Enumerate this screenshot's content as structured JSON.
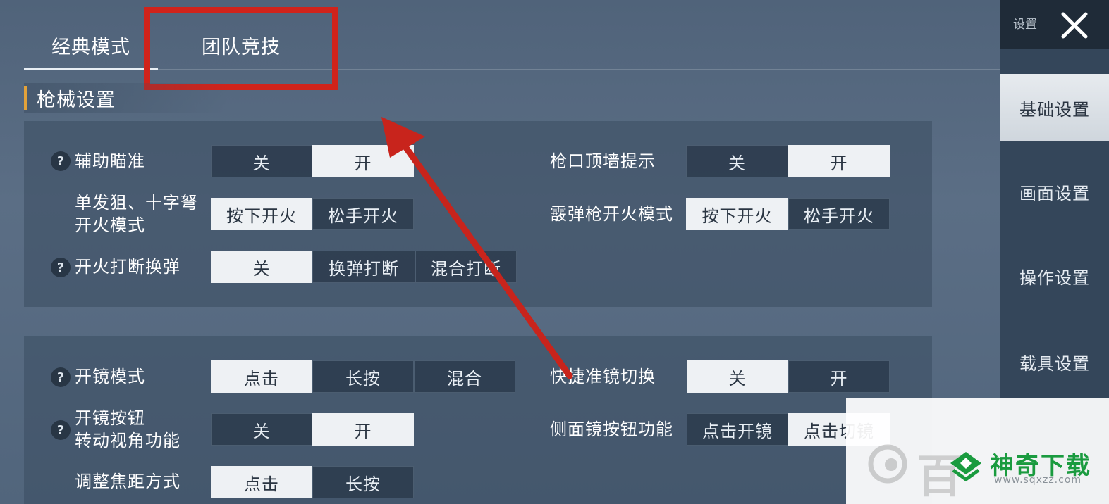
{
  "tabs": [
    {
      "label": "经典模式",
      "active": true
    },
    {
      "label": "团队竞技",
      "active": false
    }
  ],
  "section": {
    "title": "枪械设置"
  },
  "panel1": {
    "aim_assist": {
      "label": "辅助瞄准",
      "options": [
        "关",
        "开"
      ],
      "selected": "开"
    },
    "sniper_fire": {
      "label_line1": "单发狙、十字弩",
      "label_line2": "开火模式",
      "options": [
        "按下开火",
        "松手开火"
      ],
      "selected": "按下开火"
    },
    "fire_interrupt": {
      "label": "开火打断换弹",
      "options": [
        "关",
        "换弹打断",
        "混合打断"
      ],
      "selected": "关"
    },
    "muzzle_wall": {
      "label": "枪口顶墙提示",
      "options": [
        "关",
        "开"
      ],
      "selected": "开"
    },
    "shotgun_fire": {
      "label": "霰弹枪开火模式",
      "options": [
        "按下开火",
        "松手开火"
      ],
      "selected": "按下开火"
    }
  },
  "panel2": {
    "scope_mode": {
      "label": "开镜模式",
      "options": [
        "点击",
        "长按",
        "混合"
      ],
      "selected": "点击"
    },
    "scope_button": {
      "label_line1": "开镜按钮",
      "label_line2": "转动视角功能",
      "options": [
        "关",
        "开"
      ],
      "selected": "开"
    },
    "zoom_adjust": {
      "label": "调整焦距方式",
      "options": [
        "点击",
        "长按"
      ],
      "selected": "点击"
    },
    "quick_scope": {
      "label": "快捷准镜切换",
      "options": [
        "关",
        "开"
      ],
      "selected": "关"
    },
    "side_scope": {
      "label": "侧面镜按钮功能",
      "options": [
        "点击开镜",
        "点击切镜"
      ],
      "selected": "点击切镜"
    }
  },
  "sidebar": {
    "header": "设置",
    "items": [
      {
        "label": "基础设置",
        "active": true
      },
      {
        "label": "画面设置",
        "active": false
      },
      {
        "label": "操作设置",
        "active": false
      },
      {
        "label": "载具设置",
        "active": false
      }
    ]
  },
  "watermark": {
    "brand": "神奇下载",
    "url": "www.sqxzz.com",
    "partial": "百"
  },
  "colors": {
    "highlight": "#d0231b",
    "section_accent": "#e3a23a",
    "brand_green": "#1a9b3f"
  }
}
